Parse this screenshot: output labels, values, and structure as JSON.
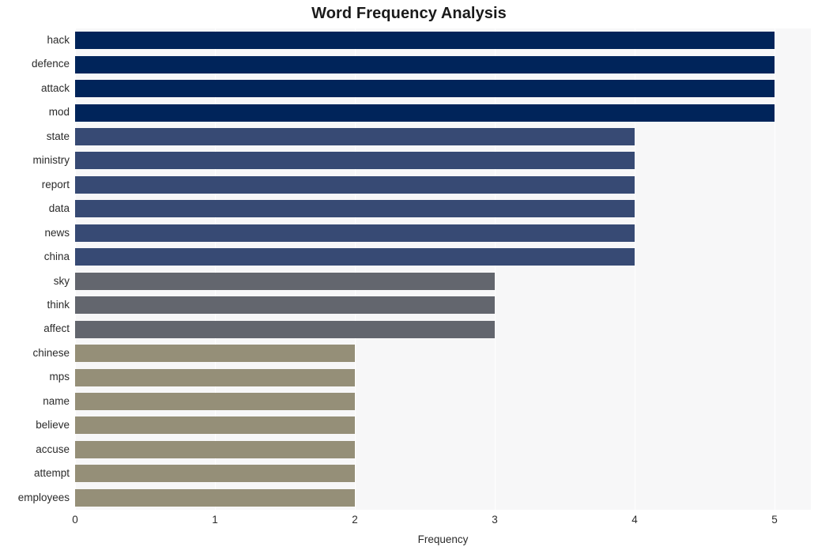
{
  "chart_data": {
    "type": "bar",
    "orientation": "horizontal",
    "title": "Word Frequency Analysis",
    "xlabel": "Frequency",
    "ylabel": "",
    "categories": [
      "hack",
      "defence",
      "attack",
      "mod",
      "state",
      "ministry",
      "report",
      "data",
      "news",
      "china",
      "sky",
      "think",
      "affect",
      "chinese",
      "mps",
      "name",
      "believe",
      "accuse",
      "attempt",
      "employees"
    ],
    "values": [
      5,
      5,
      5,
      5,
      4,
      4,
      4,
      4,
      4,
      4,
      3,
      3,
      3,
      2,
      2,
      2,
      2,
      2,
      2,
      2
    ],
    "bar_colors": [
      "#00245a",
      "#00245a",
      "#00245a",
      "#00245a",
      "#374a74",
      "#374a74",
      "#374a74",
      "#374a74",
      "#374a74",
      "#374a74",
      "#63666e",
      "#63666e",
      "#63666e",
      "#958f78",
      "#958f78",
      "#958f78",
      "#958f78",
      "#958f78",
      "#958f78",
      "#958f78"
    ],
    "xlim": [
      0,
      5.26
    ],
    "xticks": [
      0,
      1,
      2,
      3,
      4,
      5
    ],
    "xtick_labels": [
      "0",
      "1",
      "2",
      "3",
      "4",
      "5"
    ],
    "grid": "vertical",
    "legend": null,
    "colormap": "cividis",
    "plot_background": "#f7f7f8",
    "figure_background": "#ffffff",
    "gridline_color": "#ffffff"
  }
}
